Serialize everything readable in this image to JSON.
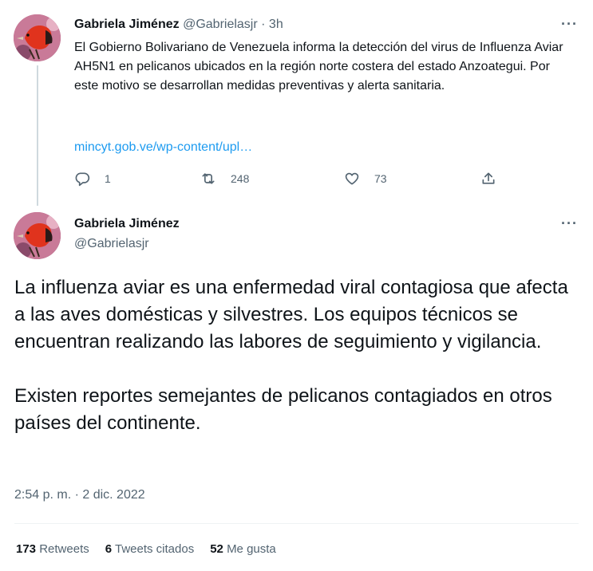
{
  "parent_tweet": {
    "author_name": "Gabriela Jiménez",
    "author_handle": "@Gabrielasjr",
    "separator": "·",
    "time": "3h",
    "text": "El Gobierno Bolivariano de Venezuela informa la detección del virus de Influenza Aviar AH5N1 en pelicanos ubicados en la región norte costera del estado Anzoategui. Por este motivo se desarrollan medidas preventivas y alerta sanitaria.",
    "link": "mincyt.gob.ve/wp-content/upl…",
    "replies": "1",
    "retweets": "248",
    "likes": "73"
  },
  "main_tweet": {
    "author_name": "Gabriela Jiménez",
    "author_handle": "@Gabrielasjr",
    "paragraph_1": "La influenza aviar es una enfermedad viral contagiosa que afecta a las aves domésticas y silvestres. Los equipos técnicos se encuentran realizando las labores de seguimiento y vigilancia.",
    "paragraph_2": "Existen reportes semejantes de pelicanos contagiados en otros países del continente.",
    "timestamp": "2:54 p. m. · 2 dic. 2022",
    "stats": {
      "retweets_count": "173",
      "retweets_label": "Retweets",
      "quotes_count": "6",
      "quotes_label": "Tweets citados",
      "likes_count": "52",
      "likes_label": "Me gusta"
    }
  },
  "more_glyph": "···",
  "icons": [
    "reply-icon",
    "retweet-icon",
    "like-icon",
    "share-icon",
    "more-icon"
  ],
  "colors": {
    "link": "#1d9bf0",
    "muted": "#536471",
    "text": "#0f1419",
    "thread_line": "#cfd9de"
  }
}
